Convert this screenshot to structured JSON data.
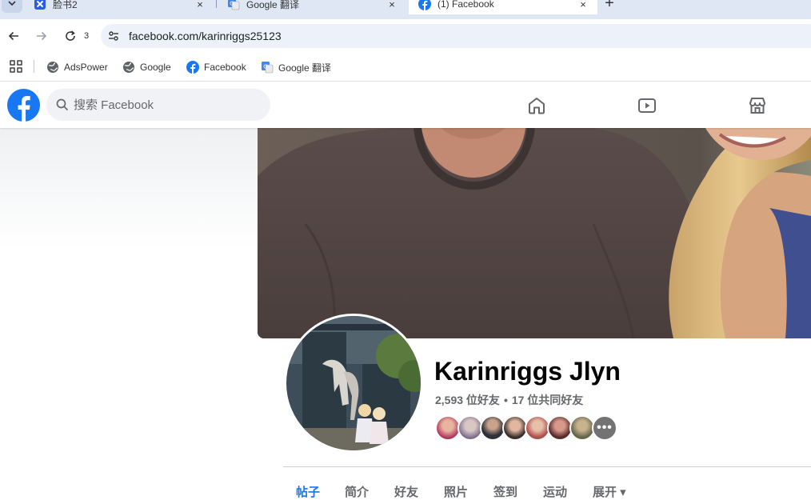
{
  "browser": {
    "tabs": [
      {
        "title": "脸书2",
        "active": false
      },
      {
        "title": "Google 翻译",
        "active": false
      },
      {
        "title": "(1) Facebook",
        "active": true
      }
    ],
    "close_glyph": "×",
    "new_tab_glyph": "+",
    "reload_count": "3",
    "url": "facebook.com/karinriggs25123",
    "bookmarks": [
      {
        "label": "AdsPower",
        "icon": "globe-icon"
      },
      {
        "label": "Google",
        "icon": "globe-icon"
      },
      {
        "label": "Facebook",
        "icon": "facebook-icon"
      },
      {
        "label": "Google 翻译",
        "icon": "google-translate-icon"
      }
    ]
  },
  "facebook": {
    "brand_color": "#1877f2",
    "search_placeholder": "搜索 Facebook",
    "nav_icons": [
      "home-icon",
      "watch-icon",
      "marketplace-icon"
    ]
  },
  "profile": {
    "name": "Karinriggs Jlyn",
    "friend_count": "2,593 位好友",
    "separator": "•",
    "mutual_friends": "17 位共同好友",
    "more_glyph": "•••",
    "tabs": [
      {
        "label": "帖子",
        "active": true
      },
      {
        "label": "简介",
        "active": false
      },
      {
        "label": "好友",
        "active": false
      },
      {
        "label": "照片",
        "active": false
      },
      {
        "label": "签到",
        "active": false
      },
      {
        "label": "运动",
        "active": false
      },
      {
        "label": "展开 ▾",
        "active": false
      }
    ]
  }
}
